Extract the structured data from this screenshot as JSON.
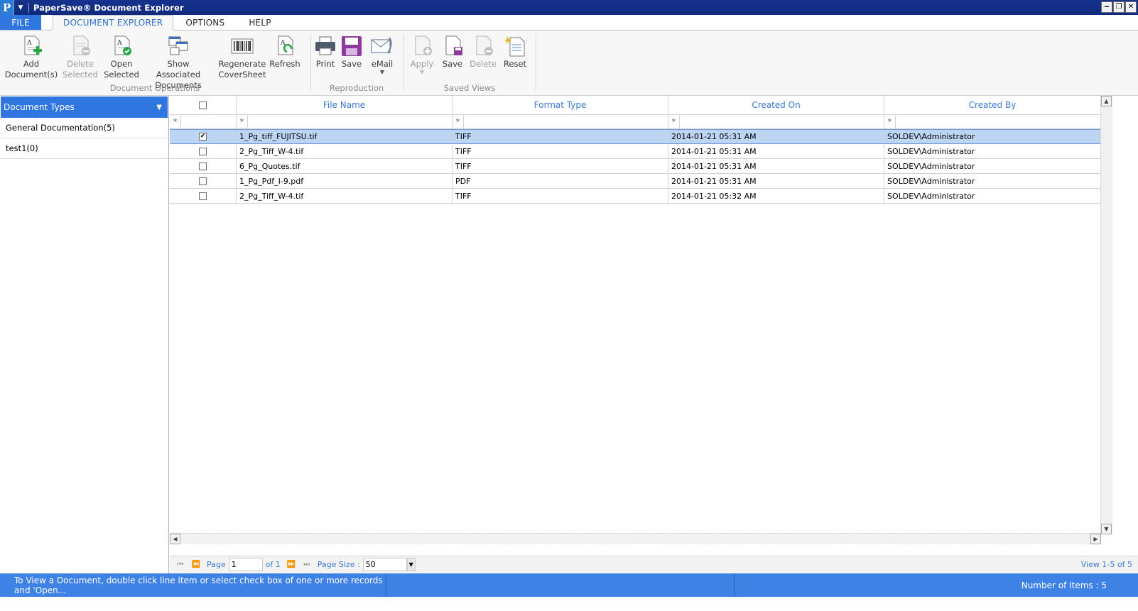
{
  "window": {
    "app_icon_letter": "P",
    "title": "PaperSave® Document Explorer",
    "minimize": "‒",
    "restore": "❐",
    "close": "✕"
  },
  "tabs": [
    "FILE",
    "DOCUMENT EXPLORER",
    "OPTIONS",
    "HELP"
  ],
  "ribbon": {
    "document_operations": {
      "label": "Document Operations",
      "buttons": [
        {
          "line1": "Add",
          "line2": "Document(s)",
          "icon": "add-document-icon"
        },
        {
          "line1": "Delete",
          "line2": "Selected",
          "icon": "delete-document-icon"
        },
        {
          "line1": "Open",
          "line2": "Selected",
          "icon": "open-document-icon"
        },
        {
          "line1": "Show Associated",
          "line2": "Documents",
          "icon": "associated-documents-icon"
        },
        {
          "line1": "Regenerate",
          "line2": "CoverSheet",
          "icon": "barcode-icon"
        },
        {
          "line1": "Refresh",
          "line2": "",
          "icon": "refresh-icon"
        }
      ]
    },
    "reproduction": {
      "label": "Reproduction",
      "buttons": [
        {
          "line1": "Print",
          "icon": "printer-icon"
        },
        {
          "line1": "Save",
          "icon": "floppy-disk-icon"
        },
        {
          "line1": "eMail",
          "icon": "email-icon"
        }
      ]
    },
    "saved_views": {
      "label": "Saved Views",
      "buttons": [
        {
          "line1": "Apply",
          "icon": "apply-view-icon"
        },
        {
          "line1": "Save",
          "icon": "save-view-icon"
        },
        {
          "line1": "Delete",
          "icon": "delete-view-icon"
        },
        {
          "line1": "Reset",
          "icon": "reset-view-icon"
        }
      ]
    }
  },
  "left_panel": {
    "title": "Document Types",
    "pin_icon": "📌",
    "items": [
      "General Documentation(5)",
      "test1(0)"
    ]
  },
  "grid": {
    "columns": [
      "File Name",
      "Format Type",
      "Created On",
      "Created By"
    ],
    "filter_symbol": "*",
    "rows": [
      {
        "checked": true,
        "file_name": "1_Pg_tiff_FUJITSU.tif",
        "format": "TIFF",
        "created_on": "2014-01-21 05:31 AM",
        "created_by": "SOLDEV\\Administrator"
      },
      {
        "checked": false,
        "file_name": "2_Pg_Tiff_W-4.tif",
        "format": "TIFF",
        "created_on": "2014-01-21 05:31 AM",
        "created_by": "SOLDEV\\Administrator"
      },
      {
        "checked": false,
        "file_name": "6_Pg_Quotes.tif",
        "format": "TIFF",
        "created_on": "2014-01-21 05:31 AM",
        "created_by": "SOLDEV\\Administrator"
      },
      {
        "checked": false,
        "file_name": "1_Pg_Pdf_I-9.pdf",
        "format": "PDF",
        "created_on": "2014-01-21 05:31 AM",
        "created_by": "SOLDEV\\Administrator"
      },
      {
        "checked": false,
        "file_name": "2_Pg_Tiff_W-4.tif",
        "format": "TIFF",
        "created_on": "2014-01-21 05:32 AM",
        "created_by": "SOLDEV\\Administrator"
      }
    ]
  },
  "pager": {
    "page_label": "Page",
    "page_value": "1",
    "of_label": "of 1",
    "page_size_label": "Page Size :",
    "page_size_value": "50",
    "view_summary": "View 1-5 of 5"
  },
  "status": {
    "hint": "To View a Document, double click line item or select check box of one or more records and 'Open...",
    "items_count": "Number of Items : 5"
  },
  "colors": {
    "accent": "#2f76e0",
    "title_bar": "#16328e",
    "status_bar": "#3f82e6",
    "selected_row": "#bcd5f3",
    "header_text": "#3a7bd5"
  }
}
